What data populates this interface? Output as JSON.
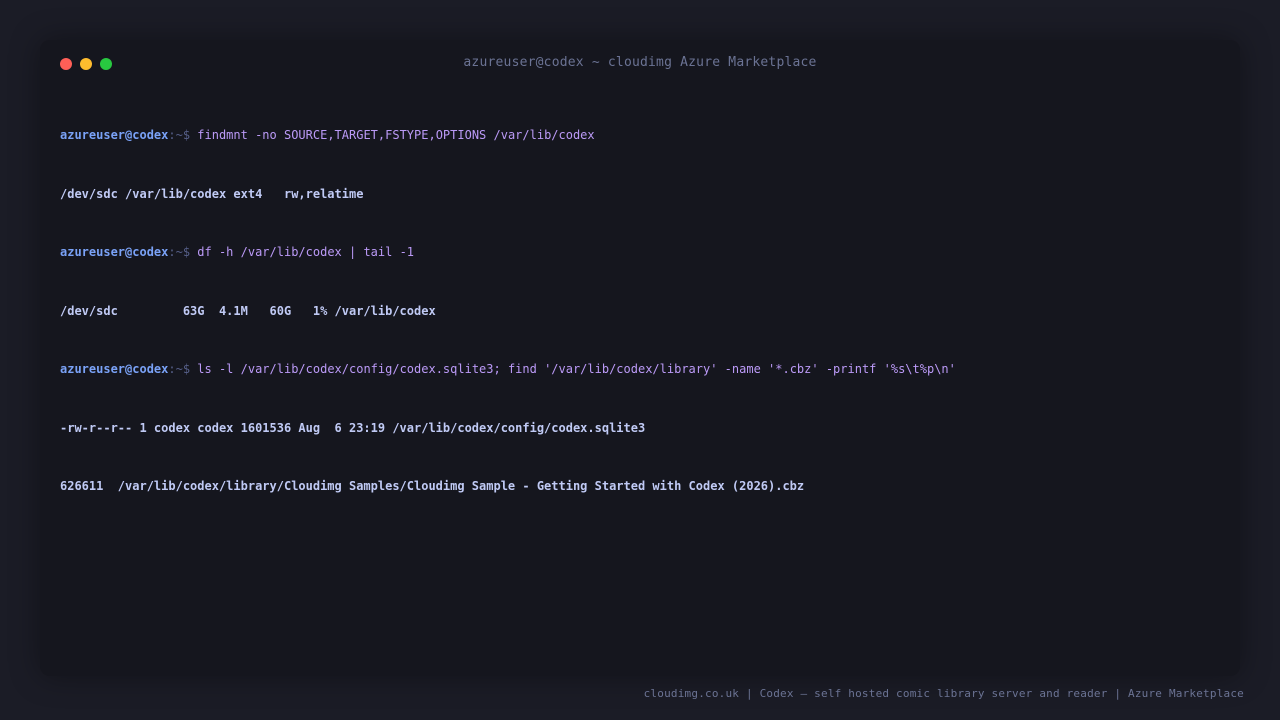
{
  "window": {
    "title": "azureuser@codex ~ cloudimg Azure Marketplace"
  },
  "terminal": {
    "prompt_user": "azureuser@codex",
    "prompt_suffix": ":~$ ",
    "commands": [
      "findmnt -no SOURCE,TARGET,FSTYPE,OPTIONS /var/lib/codex",
      "df -h /var/lib/codex | tail -1",
      "ls -l /var/lib/codex/config/codex.sqlite3; find '/var/lib/codex/library' -name '*.cbz' -printf '%s\\t%p\\n'"
    ],
    "outputs": [
      "/dev/sdc /var/lib/codex ext4   rw,relatime",
      "/dev/sdc         63G  4.1M   60G   1% /var/lib/codex",
      "-rw-r--r-- 1 codex codex 1601536 Aug  6 23:19 /var/lib/codex/config/codex.sqlite3",
      "626611  /var/lib/codex/library/Cloudimg Samples/Cloudimg Sample - Getting Started with Codex (2026).cbz"
    ]
  },
  "footer": {
    "text": "cloudimg.co.uk | Codex — self hosted comic library server and reader | Azure Marketplace"
  },
  "colors": {
    "background": "#1b1c26",
    "window": "#15161e",
    "prompt_user": "#7aa2f7",
    "command": "#bb9af7",
    "output": "#c0caf5",
    "close_dot": "#ff5f57",
    "minimize_dot": "#febc2e",
    "maximize_dot": "#28c840"
  },
  "icons": [
    "close-dot-icon",
    "minimize-dot-icon",
    "maximize-dot-icon"
  ]
}
